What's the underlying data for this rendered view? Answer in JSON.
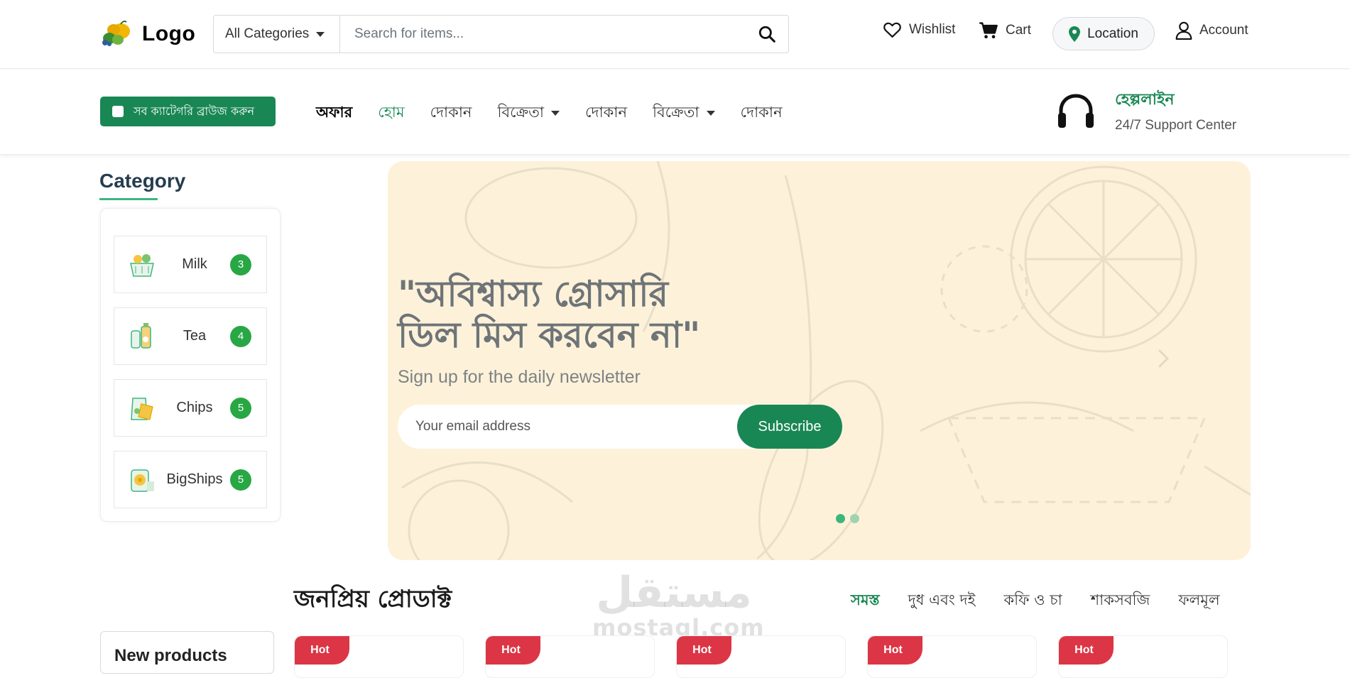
{
  "header": {
    "logo_text": "Logo",
    "category_select": "All Categories",
    "search_placeholder": "Search for items...",
    "wishlist": "Wishlist",
    "cart": "Cart",
    "location": "Location",
    "account": "Account"
  },
  "nav": {
    "browse_label": "সব ক্যাটেগরি ব্রাউজ করুন",
    "items": [
      "অফার",
      "হোম",
      "দোকান",
      "বিক্রেতা",
      "দোকান",
      "বিক্রেতা",
      "দোকান"
    ],
    "helpline_title": "হেল্পলাইন",
    "helpline_sub": "24/7 Support Center"
  },
  "sidebar": {
    "title": "Category",
    "items": [
      {
        "name": "Milk",
        "count": "3"
      },
      {
        "name": "Tea",
        "count": "4"
      },
      {
        "name": "Chips",
        "count": "5"
      },
      {
        "name": "BigShips",
        "count": "5"
      }
    ]
  },
  "hero": {
    "title_line1": "\"অবিশ্বাস্য গ্রোসারি",
    "title_line2": "ডিল মিস করবেন না\"",
    "subtitle": "Sign up for the daily newsletter",
    "email_placeholder": "Your email address",
    "subscribe": "Subscribe",
    "active_slide": 1,
    "slide_count": 2
  },
  "popular": {
    "title": "জনপ্রিয় প্রোডাক্ট",
    "tabs": [
      "সমস্ত",
      "দুধ এবং দই",
      "কফি ও চা",
      "শাকসবজি",
      "ফলমূল"
    ],
    "new_products": "New products",
    "badge": "Hot"
  },
  "watermark": {
    "arabic": "مستقل",
    "latin": "mostaql.com"
  },
  "colors": {
    "primary": "#198754",
    "accent": "#3bb77e",
    "hero_bg": "#fdf2d9",
    "hot": "#dc3545"
  }
}
